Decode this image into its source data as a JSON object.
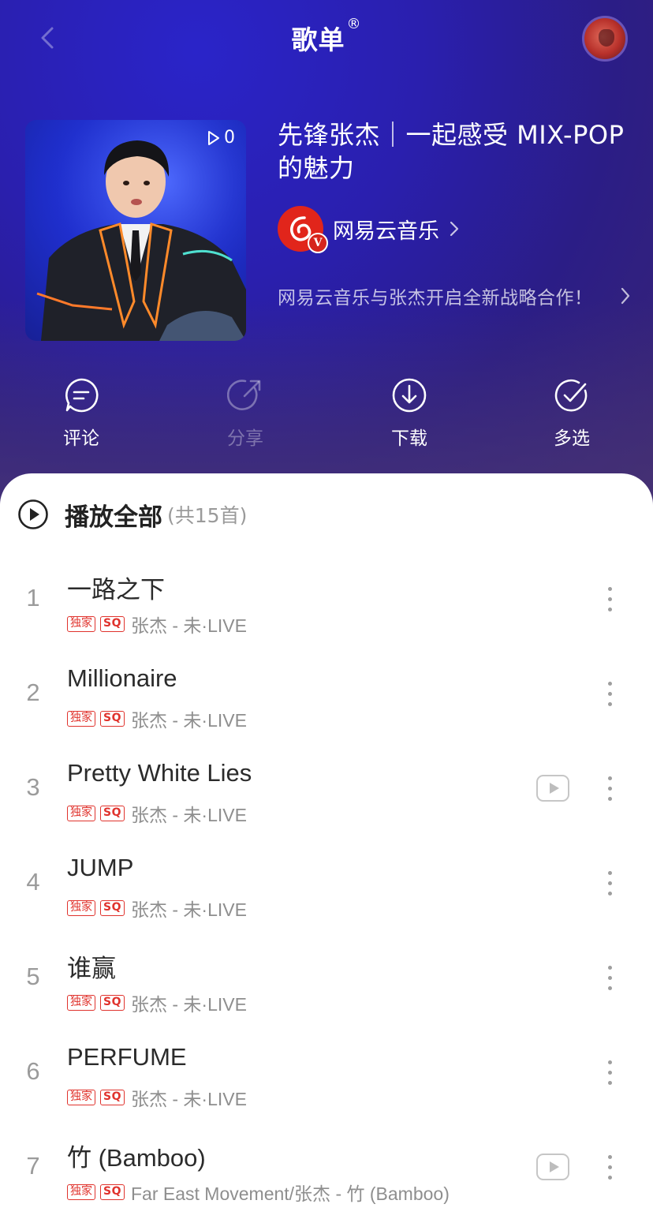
{
  "header": {
    "title": "歌单",
    "title_mark": "®"
  },
  "cover": {
    "play_count": "0"
  },
  "playlist": {
    "title": "先锋张杰｜一起感受 MIX-POP的魅力",
    "creator": "网易云音乐",
    "creator_badge": "V",
    "description": "网易云音乐与张杰开启全新战略合作！"
  },
  "actions": {
    "comment": "评论",
    "share": "分享",
    "download": "下载",
    "multi_select": "多选"
  },
  "play_all": {
    "label": "播放全部",
    "count": "(共15首)"
  },
  "tags": {
    "exclusive": "独家",
    "sq": "SQ"
  },
  "songs": [
    {
      "index": "1",
      "title": "一路之下",
      "artist": "张杰 - 未·LIVE",
      "has_mv": false
    },
    {
      "index": "2",
      "title": "Millionaire",
      "artist": "张杰 - 未·LIVE",
      "has_mv": false
    },
    {
      "index": "3",
      "title": "Pretty White Lies",
      "artist": "张杰 - 未·LIVE",
      "has_mv": true
    },
    {
      "index": "4",
      "title": "JUMP",
      "artist": "张杰 - 未·LIVE",
      "has_mv": false
    },
    {
      "index": "5",
      "title": "谁赢",
      "artist": "张杰 - 未·LIVE",
      "has_mv": false
    },
    {
      "index": "6",
      "title": "PERFUME",
      "artist": "张杰 - 未·LIVE",
      "has_mv": false
    },
    {
      "index": "7",
      "title": "竹 (Bamboo)",
      "artist": "Far East Movement/张杰 - 竹 (Bamboo)",
      "has_mv": true
    }
  ],
  "colors": {
    "header_top": "#2a24c9",
    "header_bottom": "#4b3773",
    "accent_red": "#e0332d",
    "title_text": "#2b2b2b",
    "secondary_text": "#8e8e8e"
  },
  "icons": {
    "back": "back-icon",
    "avatar": "user-avatar",
    "comment": "comment-icon",
    "share": "share-icon",
    "download": "download-icon",
    "multi_select": "check-circle-icon",
    "play_all": "play-circle-icon",
    "mv": "mv-icon",
    "more": "more-vertical-icon"
  }
}
